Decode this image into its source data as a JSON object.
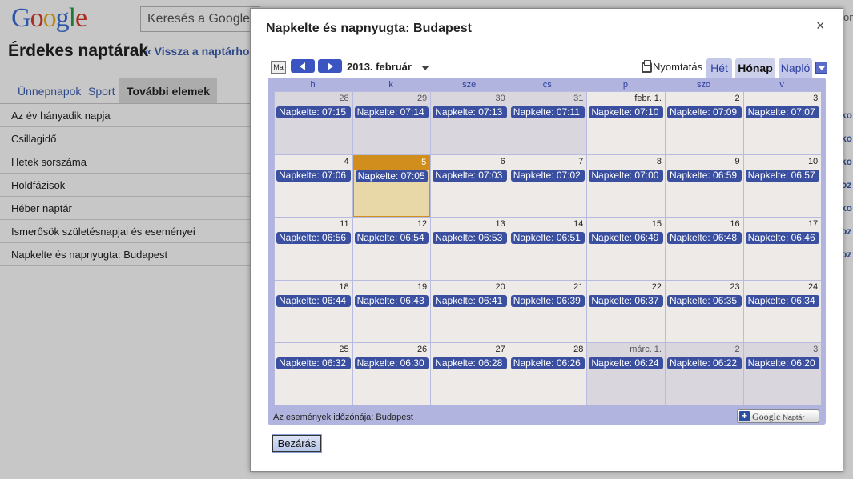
{
  "background": {
    "logo": {
      "G": "G",
      "o1": "o",
      "o2": "o",
      "g": "g",
      "l": "l",
      "e": "e"
    },
    "search_placeholder": "Keresés a Google",
    "page_title": "Érdekes naptárak",
    "back_link": "« Vissza a naptárhoz",
    "tabs": [
      {
        "label": "Ünnepnapok"
      },
      {
        "label": "Sport"
      },
      {
        "label": "További elemek"
      }
    ],
    "calendar_list": [
      "Az év hányadik napja",
      "Csillagidő",
      "Hetek sorszáma",
      "Holdfázisok",
      "Héber naptár",
      "Ismerősök születésnapjai és eseményei",
      "Napkelte és napnyugta: Budapest"
    ],
    "right_links": [
      "ko",
      "ko",
      "ko",
      "oz",
      "ko",
      "oz",
      "oz"
    ],
    "right_om": "om"
  },
  "dialog": {
    "title": "Napkelte és napnyugta: Budapest",
    "close_glyph": "×",
    "today_button": "Ma",
    "month_label": "2013. február",
    "print_label": "Nyomtatás",
    "view_tabs": {
      "week": "Hét",
      "month": "Hónap",
      "agenda": "Napló"
    },
    "weekdays": [
      "h",
      "k",
      "sze",
      "cs",
      "p",
      "szo",
      "v"
    ],
    "weeks": [
      [
        {
          "day": "28",
          "other": true,
          "event": "Napkelte: 07:15"
        },
        {
          "day": "29",
          "other": true,
          "event": "Napkelte: 07:14"
        },
        {
          "day": "30",
          "other": true,
          "event": "Napkelte: 07:13"
        },
        {
          "day": "31",
          "other": true,
          "event": "Napkelte: 07:11"
        },
        {
          "day": "febr. 1.",
          "other": false,
          "event": "Napkelte: 07:10"
        },
        {
          "day": "2",
          "other": false,
          "event": "Napkelte: 07:09"
        },
        {
          "day": "3",
          "other": false,
          "event": "Napkelte: 07:07"
        }
      ],
      [
        {
          "day": "4",
          "other": false,
          "event": "Napkelte: 07:06"
        },
        {
          "day": "5",
          "other": false,
          "today": true,
          "event": "Napkelte: 07:05"
        },
        {
          "day": "6",
          "other": false,
          "event": "Napkelte: 07:03"
        },
        {
          "day": "7",
          "other": false,
          "event": "Napkelte: 07:02"
        },
        {
          "day": "8",
          "other": false,
          "event": "Napkelte: 07:00"
        },
        {
          "day": "9",
          "other": false,
          "event": "Napkelte: 06:59"
        },
        {
          "day": "10",
          "other": false,
          "event": "Napkelte: 06:57"
        }
      ],
      [
        {
          "day": "11",
          "other": false,
          "event": "Napkelte: 06:56"
        },
        {
          "day": "12",
          "other": false,
          "event": "Napkelte: 06:54"
        },
        {
          "day": "13",
          "other": false,
          "event": "Napkelte: 06:53"
        },
        {
          "day": "14",
          "other": false,
          "event": "Napkelte: 06:51"
        },
        {
          "day": "15",
          "other": false,
          "event": "Napkelte: 06:49"
        },
        {
          "day": "16",
          "other": false,
          "event": "Napkelte: 06:48"
        },
        {
          "day": "17",
          "other": false,
          "event": "Napkelte: 06:46"
        }
      ],
      [
        {
          "day": "18",
          "other": false,
          "event": "Napkelte: 06:44"
        },
        {
          "day": "19",
          "other": false,
          "event": "Napkelte: 06:43"
        },
        {
          "day": "20",
          "other": false,
          "event": "Napkelte: 06:41"
        },
        {
          "day": "21",
          "other": false,
          "event": "Napkelte: 06:39"
        },
        {
          "day": "22",
          "other": false,
          "event": "Napkelte: 06:37"
        },
        {
          "day": "23",
          "other": false,
          "event": "Napkelte: 06:35"
        },
        {
          "day": "24",
          "other": false,
          "event": "Napkelte: 06:34"
        }
      ],
      [
        {
          "day": "25",
          "other": false,
          "event": "Napkelte: 06:32"
        },
        {
          "day": "26",
          "other": false,
          "event": "Napkelte: 06:30"
        },
        {
          "day": "27",
          "other": false,
          "event": "Napkelte: 06:28"
        },
        {
          "day": "28",
          "other": false,
          "event": "Napkelte: 06:26"
        },
        {
          "day": "márc. 1.",
          "other": true,
          "event": "Napkelte: 06:24"
        },
        {
          "day": "2",
          "other": true,
          "event": "Napkelte: 06:22"
        },
        {
          "day": "3",
          "other": true,
          "event": "Napkelte: 06:20"
        }
      ]
    ],
    "timezone_label": "Az események időzónája: Budapest",
    "gcal_button": {
      "plus": "+",
      "google": "Google",
      "sub": "Naptár"
    },
    "close_button": "Bezárás",
    "colors": {
      "event_bg": "#3a4fa0",
      "today_bar": "#d28e1c",
      "frame": "#b0b4de"
    }
  }
}
